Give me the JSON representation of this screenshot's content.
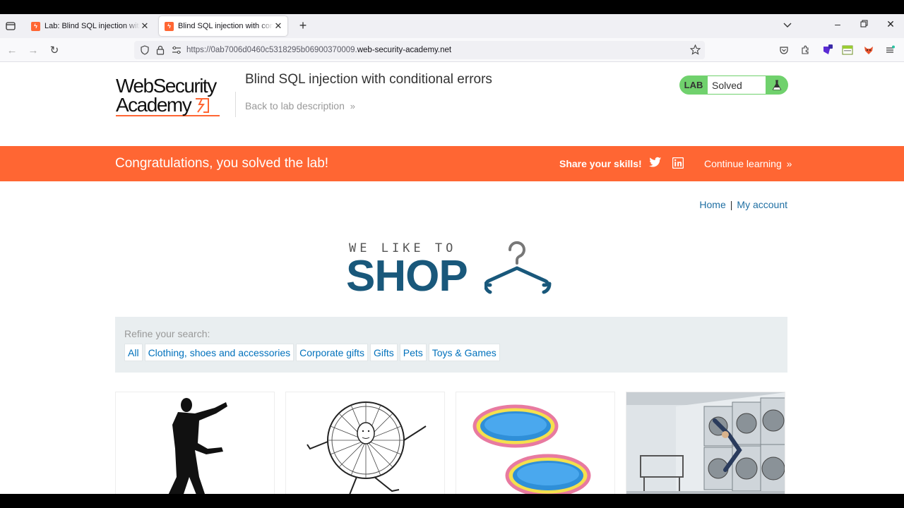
{
  "browser": {
    "tabs": [
      {
        "title": "Lab: Blind SQL injection with co",
        "active": false
      },
      {
        "title": "Blind SQL injection with conditi",
        "active": true
      }
    ],
    "url_prefix": "https://0ab7006d0460c5318295b06900370009.",
    "url_domain": "web-security-academy.net"
  },
  "header": {
    "logo_line1": "WebSecurity",
    "logo_line2": "Academy",
    "lab_title": "Blind SQL injection with conditional errors",
    "back_link": "Back to lab description",
    "badge_label": "LAB",
    "badge_status": "Solved"
  },
  "banner": {
    "message": "Congratulations, you solved the lab!",
    "share": "Share your skills!",
    "continue": "Continue learning"
  },
  "topnav": {
    "home": "Home",
    "separator": "|",
    "account": "My account"
  },
  "shop_logo": {
    "tagline": "WE LIKE TO",
    "word": "SHOP"
  },
  "filters": {
    "label": "Refine your search:",
    "categories": [
      "All",
      "Clothing, shoes and accessories",
      "Corporate gifts",
      "Gifts",
      "Pets",
      "Toys & Games"
    ]
  },
  "products": [
    {
      "icon": "silhouette-man-image"
    },
    {
      "icon": "wheel-man-drawing-image"
    },
    {
      "icon": "paddling-pools-image"
    },
    {
      "icon": "laundrette-image"
    }
  ],
  "colors": {
    "accent": "#ff6633",
    "solved": "#70d16d",
    "link": "#0071bc",
    "shop_blue": "#19587b"
  }
}
